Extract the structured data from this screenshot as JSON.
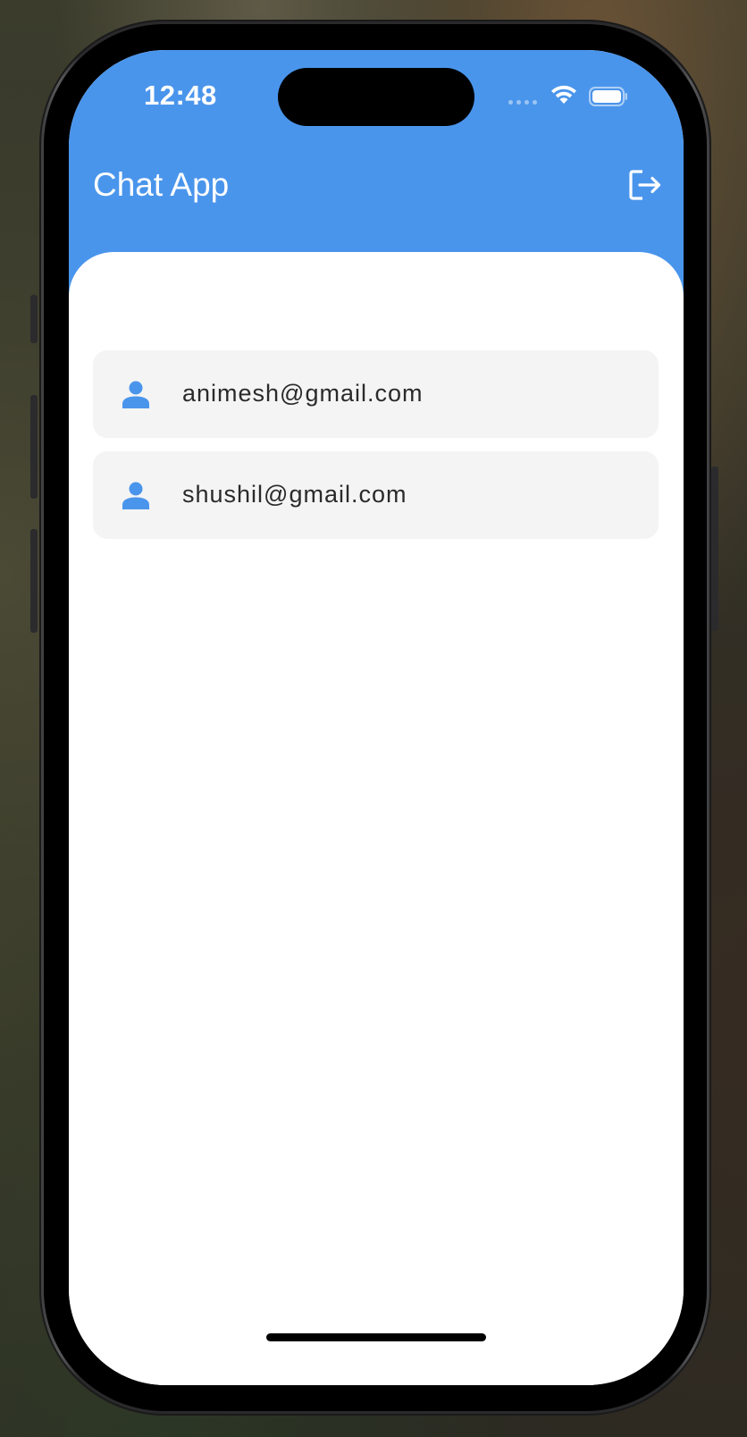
{
  "status_bar": {
    "time": "12:48"
  },
  "app_bar": {
    "title": "Chat App",
    "logout_icon": "logout-icon",
    "color": "#4a95ec"
  },
  "users": [
    {
      "email": "animesh@gmail.com",
      "icon": "person-icon"
    },
    {
      "email": "shushil@gmail.com",
      "icon": "person-icon"
    }
  ],
  "colors": {
    "accent": "#4a95ec",
    "list_item_bg": "#f4f4f4",
    "text": "#2a2a2a"
  }
}
